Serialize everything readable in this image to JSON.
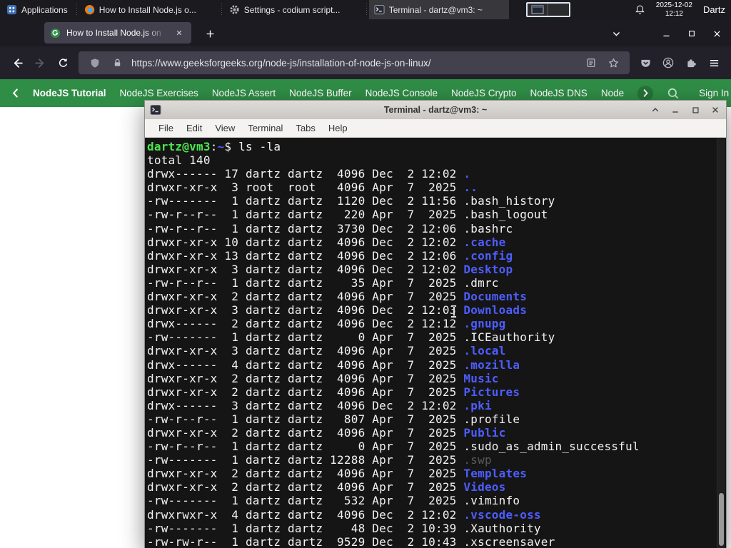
{
  "panel": {
    "applications": "Applications",
    "tasks": [
      {
        "title": "How to Install Node.js o..."
      },
      {
        "title": "Settings - codium script..."
      },
      {
        "title": "Terminal - dartz@vm3: ~"
      }
    ],
    "clock": {
      "date": "2025-12-02",
      "time": "12:12"
    },
    "user": "Dartz"
  },
  "browser": {
    "tab": {
      "title": "How to Install Node.js on"
    },
    "url": "https://www.geeksforgeeks.org/node-js/installation-of-node-js-on-linux/",
    "nav": {
      "items": [
        "NodeJS Tutorial",
        "NodeJS Exercises",
        "NodeJS Assert",
        "NodeJS Buffer",
        "NodeJS Console",
        "NodeJS Crypto",
        "NodeJS DNS",
        "Node"
      ],
      "sign_in": "Sign In"
    }
  },
  "terminal": {
    "title": "Terminal - dartz@vm3: ~",
    "menu": [
      "File",
      "Edit",
      "View",
      "Terminal",
      "Tabs",
      "Help"
    ],
    "lines": [
      [
        {
          "t": "dartz@vm3",
          "c": "green"
        },
        {
          "t": ":",
          "c": "fg"
        },
        {
          "t": "~",
          "c": "blue"
        },
        {
          "t": "$ ",
          "c": "fg"
        },
        {
          "t": "ls -la",
          "c": "fg"
        }
      ],
      [
        {
          "t": "total 140",
          "c": "fg"
        }
      ],
      [
        {
          "t": "drwx------ 17 dartz dartz  4096 Dec  2 12:02 ",
          "c": "fg"
        },
        {
          "t": ".",
          "c": "blue"
        }
      ],
      [
        {
          "t": "drwxr-xr-x  3 root  root   4096 Apr  7  2025 ",
          "c": "fg"
        },
        {
          "t": "..",
          "c": "blue"
        }
      ],
      [
        {
          "t": "-rw-------  1 dartz dartz  1120 Dec  2 11:56 ",
          "c": "fg"
        },
        {
          "t": ".bash_history",
          "c": "fg"
        }
      ],
      [
        {
          "t": "-rw-r--r--  1 dartz dartz   220 Apr  7  2025 ",
          "c": "fg"
        },
        {
          "t": ".bash_logout",
          "c": "fg"
        }
      ],
      [
        {
          "t": "-rw-r--r--  1 dartz dartz  3730 Dec  2 12:06 ",
          "c": "fg"
        },
        {
          "t": ".bashrc",
          "c": "fg"
        }
      ],
      [
        {
          "t": "drwxr-xr-x 10 dartz dartz  4096 Dec  2 12:02 ",
          "c": "fg"
        },
        {
          "t": ".cache",
          "c": "blue"
        }
      ],
      [
        {
          "t": "drwxr-xr-x 13 dartz dartz  4096 Dec  2 12:06 ",
          "c": "fg"
        },
        {
          "t": ".config",
          "c": "blue"
        }
      ],
      [
        {
          "t": "drwxr-xr-x  3 dartz dartz  4096 Dec  2 12:02 ",
          "c": "fg"
        },
        {
          "t": "Desktop",
          "c": "blue"
        }
      ],
      [
        {
          "t": "-rw-r--r--  1 dartz dartz    35 Apr  7  2025 ",
          "c": "fg"
        },
        {
          "t": ".dmrc",
          "c": "fg"
        }
      ],
      [
        {
          "t": "drwxr-xr-x  2 dartz dartz  4096 Apr  7  2025 ",
          "c": "fg"
        },
        {
          "t": "Documents",
          "c": "blue"
        }
      ],
      [
        {
          "t": "drwxr-xr-x  3 dartz dartz  4096 Dec  2 12:03 ",
          "c": "fg"
        },
        {
          "t": "Downloads",
          "c": "blue"
        }
      ],
      [
        {
          "t": "drwx------  2 dartz dartz  4096 Dec  2 12:12 ",
          "c": "fg"
        },
        {
          "t": ".gnupg",
          "c": "blue"
        }
      ],
      [
        {
          "t": "-rw-------  1 dartz dartz     0 Apr  7  2025 ",
          "c": "fg"
        },
        {
          "t": ".ICEauthority",
          "c": "fg"
        }
      ],
      [
        {
          "t": "drwxr-xr-x  3 dartz dartz  4096 Apr  7  2025 ",
          "c": "fg"
        },
        {
          "t": ".local",
          "c": "blue"
        }
      ],
      [
        {
          "t": "drwx------  4 dartz dartz  4096 Apr  7  2025 ",
          "c": "fg"
        },
        {
          "t": ".mozilla",
          "c": "blue"
        }
      ],
      [
        {
          "t": "drwxr-xr-x  2 dartz dartz  4096 Apr  7  2025 ",
          "c": "fg"
        },
        {
          "t": "Music",
          "c": "blue"
        }
      ],
      [
        {
          "t": "drwxr-xr-x  2 dartz dartz  4096 Apr  7  2025 ",
          "c": "fg"
        },
        {
          "t": "Pictures",
          "c": "blue"
        }
      ],
      [
        {
          "t": "drwx------  3 dartz dartz  4096 Dec  2 12:02 ",
          "c": "fg"
        },
        {
          "t": ".pki",
          "c": "blue"
        }
      ],
      [
        {
          "t": "-rw-r--r--  1 dartz dartz   807 Apr  7  2025 ",
          "c": "fg"
        },
        {
          "t": ".profile",
          "c": "fg"
        }
      ],
      [
        {
          "t": "drwxr-xr-x  2 dartz dartz  4096 Apr  7  2025 ",
          "c": "fg"
        },
        {
          "t": "Public",
          "c": "blue"
        }
      ],
      [
        {
          "t": "-rw-r--r--  1 dartz dartz     0 Apr  7  2025 ",
          "c": "fg"
        },
        {
          "t": ".sudo_as_admin_successful",
          "c": "fg"
        }
      ],
      [
        {
          "t": "-rw-------  1 dartz dartz 12288 Apr  7  2025 ",
          "c": "fg"
        },
        {
          "t": ".swp",
          "c": "dim"
        }
      ],
      [
        {
          "t": "drwxr-xr-x  2 dartz dartz  4096 Apr  7  2025 ",
          "c": "fg"
        },
        {
          "t": "Templates",
          "c": "blue"
        }
      ],
      [
        {
          "t": "drwxr-xr-x  2 dartz dartz  4096 Apr  7  2025 ",
          "c": "fg"
        },
        {
          "t": "Videos",
          "c": "blue"
        }
      ],
      [
        {
          "t": "-rw-------  1 dartz dartz   532 Apr  7  2025 ",
          "c": "fg"
        },
        {
          "t": ".viminfo",
          "c": "fg"
        }
      ],
      [
        {
          "t": "drwxrwxr-x  4 dartz dartz  4096 Dec  2 12:02 ",
          "c": "fg"
        },
        {
          "t": ".vscode-oss",
          "c": "blue"
        }
      ],
      [
        {
          "t": "-rw-------  1 dartz dartz    48 Dec  2 10:39 ",
          "c": "fg"
        },
        {
          "t": ".Xauthority",
          "c": "fg"
        }
      ],
      [
        {
          "t": "-rw-rw-r--  1 dartz dartz  9529 Dec  2 10:43 ",
          "c": "fg"
        },
        {
          "t": ".xscreensaver",
          "c": "fg"
        }
      ]
    ]
  },
  "colors": {
    "gfg_green": "#2f8d46",
    "term_bg": "#151515",
    "term_fg": "#f2f2f2",
    "term_green": "#4ce64c",
    "term_blue": "#4e5dff"
  }
}
